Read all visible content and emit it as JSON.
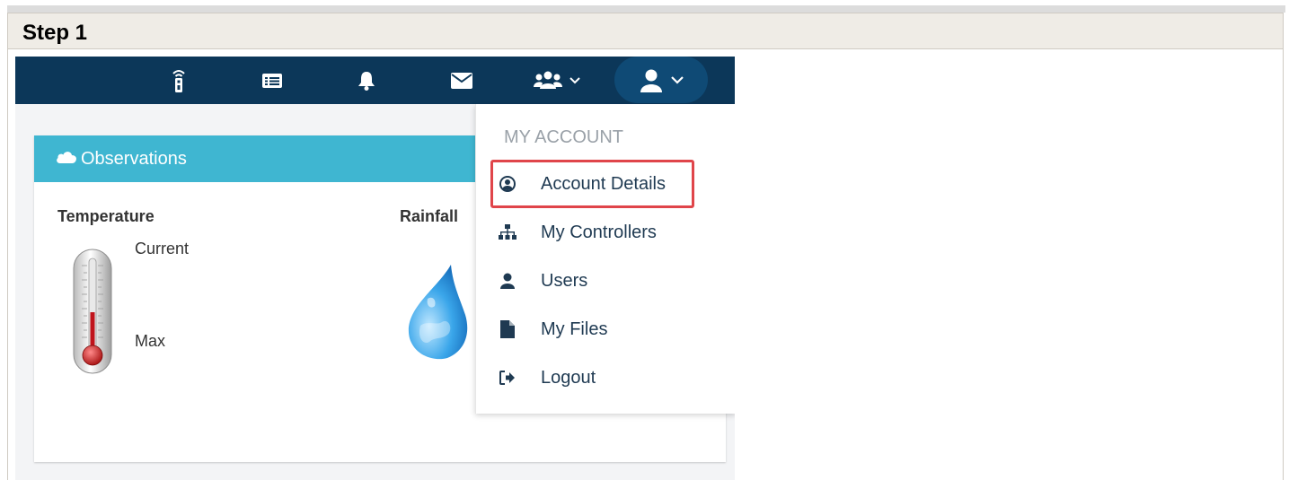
{
  "doc": {
    "step_title": "Step 1"
  },
  "navbar": {
    "icons": [
      "remote-icon",
      "list-icon",
      "bell-icon",
      "envelope-icon",
      "users-icon",
      "user-icon"
    ]
  },
  "observations": {
    "title": "Observations",
    "temperature_label": "Temperature",
    "current_label": "Current",
    "max_label": "Max",
    "rainfall_label": "Rainfall"
  },
  "account_menu": {
    "header": "MY ACCOUNT",
    "items": [
      {
        "label": "Account Details",
        "icon": "user-circle-icon",
        "highlighted": true
      },
      {
        "label": "My Controllers",
        "icon": "sitemap-icon"
      },
      {
        "label": "Users",
        "icon": "user-icon"
      },
      {
        "label": "My Files",
        "icon": "file-icon"
      },
      {
        "label": "Logout",
        "icon": "sign-out-icon"
      }
    ]
  },
  "colors": {
    "navbar": "#0c3759",
    "card_header": "#3fb6d1",
    "highlight_border": "#e0454a"
  }
}
